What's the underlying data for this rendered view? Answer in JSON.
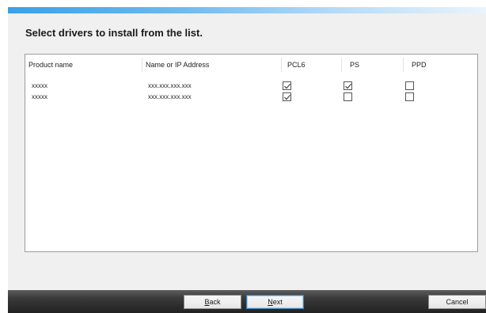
{
  "dialog": {
    "heading": "Select drivers to install from the list."
  },
  "table": {
    "columns": [
      "Product name",
      "Name or IP Address",
      "PCL6",
      "PS",
      "PPD"
    ],
    "rows": [
      {
        "product": "xxxxx",
        "address": "xxx.xxx.xxx.xxx",
        "pcl6": true,
        "ps": true,
        "ppd": false
      },
      {
        "product": "xxxxx",
        "address": "xxx.xxx.xxx.xxx",
        "pcl6": true,
        "ps": false,
        "ppd": false
      }
    ]
  },
  "buttons": {
    "back_first": "B",
    "back_rest": "ack",
    "next_first": "N",
    "next_rest": "ext",
    "cancel": "Cancel"
  }
}
